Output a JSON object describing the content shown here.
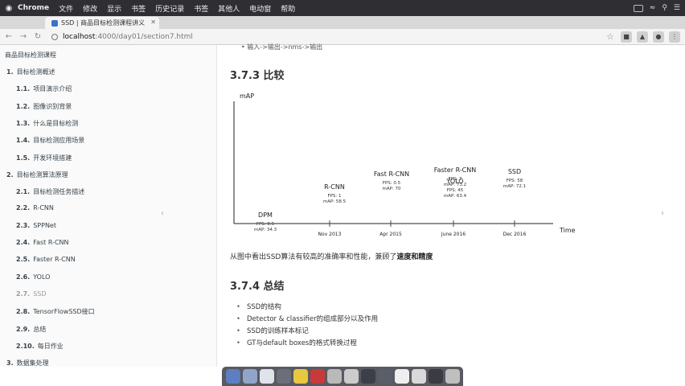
{
  "menubar": {
    "items": [
      "Chrome",
      "文件",
      "修改",
      "显示",
      "书签",
      "历史记录",
      "书签",
      "其他人",
      "电动窗",
      "帮助"
    ]
  },
  "browser": {
    "tab_title": "SSD | 商品目标检测课程讲义",
    "address_host": "localhost",
    "address_path": ":4000/day01/section7.html"
  },
  "sidebar": {
    "title": "商品目标检测课程",
    "items": [
      {
        "num": "1.",
        "label": "目标检测概述"
      },
      {
        "num": "1.1.",
        "label": "项目演示介绍"
      },
      {
        "num": "1.2.",
        "label": "图像识别背景"
      },
      {
        "num": "1.3.",
        "label": "什么是目标检测"
      },
      {
        "num": "1.4.",
        "label": "目标检测应用场景"
      },
      {
        "num": "1.5.",
        "label": "开发环境搭建"
      },
      {
        "num": "2.",
        "label": "目标检测算法原理"
      },
      {
        "num": "2.1.",
        "label": "目标检测任务描述"
      },
      {
        "num": "2.2.",
        "label": "R-CNN"
      },
      {
        "num": "2.3.",
        "label": "SPPNet"
      },
      {
        "num": "2.4.",
        "label": "Fast R-CNN"
      },
      {
        "num": "2.5.",
        "label": "Faster R-CNN"
      },
      {
        "num": "2.6.",
        "label": "YOLO"
      },
      {
        "num": "2.7.",
        "label": "SSD"
      },
      {
        "num": "2.8.",
        "label": "TensorFlowSSD接口"
      },
      {
        "num": "2.9.",
        "label": "总结"
      },
      {
        "num": "2.10.",
        "label": "每日作业"
      },
      {
        "num": "3.",
        "label": "数据集处理"
      }
    ]
  },
  "content": {
    "top_bullet": "输入->输出->nms->输出",
    "section_773": "3.7.3 比较",
    "description_prefix": "从图中看出SSD算法有较高的准确率和性能，兼顾了",
    "description_bold": "速度和精度",
    "section_774": "3.7.4 总结",
    "summary": [
      "SSD的结构",
      "Detector & classifier的组成部分以及作用",
      "SSD的训练样本标记",
      "GT与default boxes的格式转换过程"
    ]
  },
  "chart_data": {
    "type": "scatter",
    "ylabel": "mAP",
    "xlabel": "Time",
    "x_ticks": [
      "Nov 2013",
      "Apr 2015",
      "June 2016",
      "Dec 2016"
    ],
    "points": [
      {
        "name": "DPM",
        "fps_label": "FPS: 0.5",
        "map_label": "mAP: 34.3",
        "x": 0,
        "fps": 0.5,
        "map": 34.3
      },
      {
        "name": "R-CNN",
        "fps_label": "FPS: 1",
        "map_label": "mAP: 58.5",
        "x": 1,
        "fps": 1,
        "map": 58.5
      },
      {
        "name": "Fast R-CNN",
        "fps_label": "FPS: 0.5",
        "map_label": "mAP: 70",
        "x": 2,
        "fps": 0.5,
        "map": 70
      },
      {
        "name": "Faster R-CNN",
        "fps_label": "FPS: 7",
        "map_label": "mAP: 73.2",
        "x": 3,
        "fps": 7,
        "map": 73.2
      },
      {
        "name": "YOLO",
        "fps_label": "FPS: 45",
        "map_label": "mAP: 63.4",
        "x": 3,
        "fps": 45,
        "map": 63.4
      },
      {
        "name": "SSD",
        "fps_label": "FPS: 58",
        "map_label": "mAP: 72.1",
        "x": 4,
        "fps": 58,
        "map": 72.1
      }
    ]
  }
}
